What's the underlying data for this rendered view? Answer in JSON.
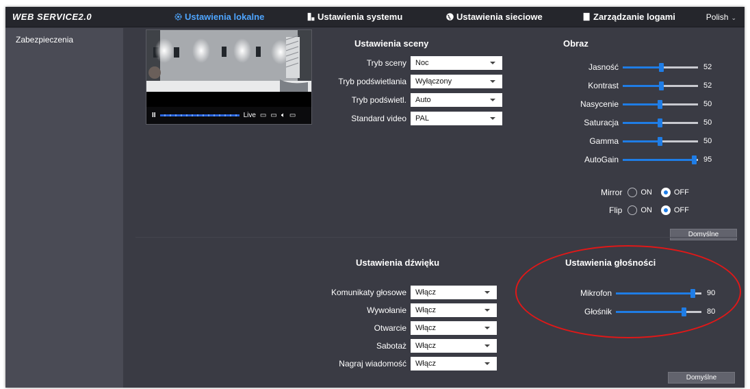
{
  "brand": "WEB SERVICE2.0",
  "nav": [
    {
      "label": "Ustawienia lokalne",
      "active": true
    },
    {
      "label": "Ustawienia systemu",
      "active": false
    },
    {
      "label": "Ustawienia sieciowe",
      "active": false
    },
    {
      "label": "Zarządzanie logami",
      "active": false
    }
  ],
  "language": "Polish",
  "sidebar": {
    "items": [
      {
        "label": "Zabezpieczenia"
      }
    ]
  },
  "video": {
    "live_label": "Live",
    "progress": 1.0
  },
  "scene": {
    "title": "Ustawienia sceny",
    "fields": [
      {
        "label": "Tryb sceny",
        "value": "Noc"
      },
      {
        "label": "Tryb podświetlania",
        "value": "Wyłączony"
      },
      {
        "label": "Tryb podświetl.",
        "value": "Auto"
      },
      {
        "label": "Standard video",
        "value": "PAL"
      }
    ]
  },
  "image": {
    "title": "Obraz",
    "sliders": [
      {
        "label": "Jasność",
        "value": 52,
        "max": 100
      },
      {
        "label": "Kontrast",
        "value": 52,
        "max": 100
      },
      {
        "label": "Nasycenie",
        "value": 50,
        "max": 100
      },
      {
        "label": "Saturacja",
        "value": 50,
        "max": 100
      },
      {
        "label": "Gamma",
        "value": 50,
        "max": 100
      },
      {
        "label": "AutoGain",
        "value": 95,
        "max": 100
      }
    ],
    "mirror": {
      "label": "Mirror",
      "on_label": "ON",
      "off_label": "OFF",
      "selected": "OFF"
    },
    "flip": {
      "label": "Flip",
      "on_label": "ON",
      "off_label": "OFF",
      "selected": "OFF"
    },
    "default_button": "Domyślne"
  },
  "sound": {
    "title": "Ustawienia dźwięku",
    "fields": [
      {
        "label": "Komunikaty głosowe",
        "value": "Włącz"
      },
      {
        "label": "Wywołanie",
        "value": "Włącz"
      },
      {
        "label": "Otwarcie",
        "value": "Włącz"
      },
      {
        "label": "Sabotaż",
        "value": "Włącz"
      },
      {
        "label": "Nagraj wiadomość",
        "value": "Włącz"
      }
    ]
  },
  "volume": {
    "title": "Ustawienia głośności",
    "sliders": [
      {
        "label": "Mikrofon",
        "value": 90,
        "max": 100
      },
      {
        "label": "Głośnik",
        "value": 80,
        "max": 100
      }
    ],
    "default_button": "Domyślne"
  },
  "colors": {
    "accent": "#1f7de6",
    "annotation": "#e01818",
    "background": "#3a3b44"
  }
}
